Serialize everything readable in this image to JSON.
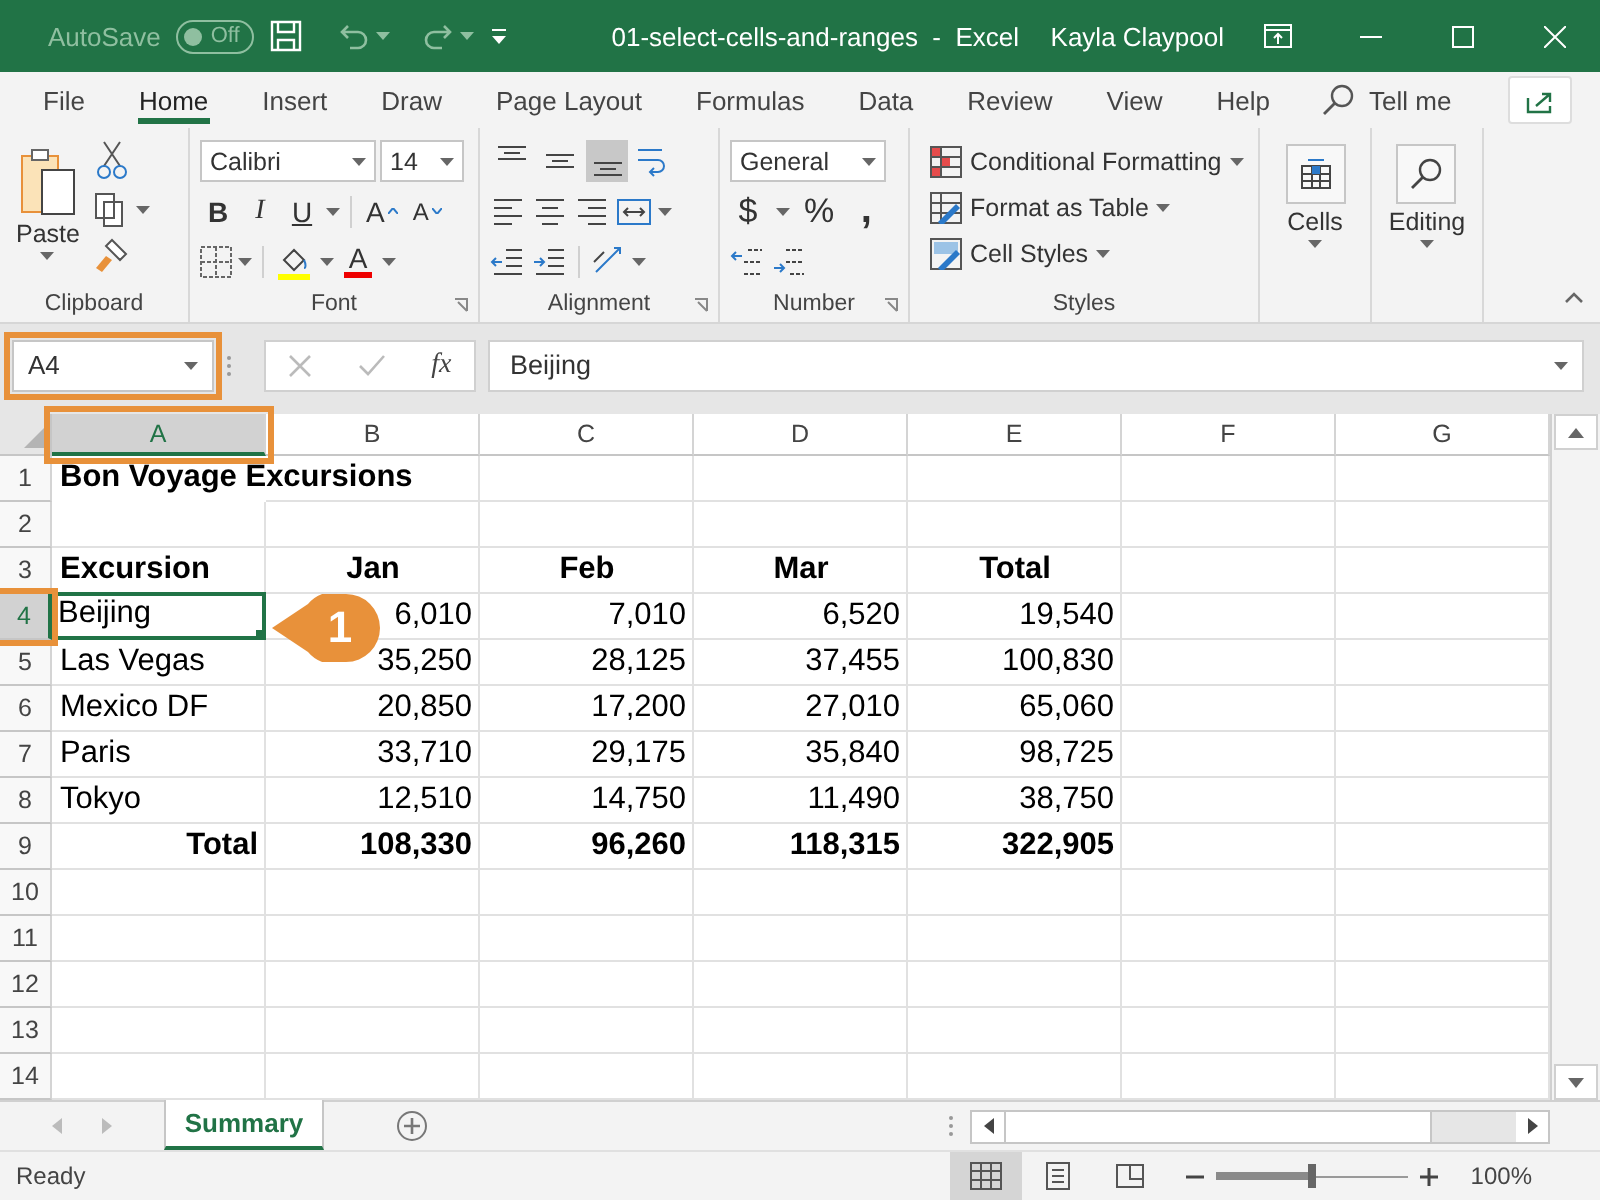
{
  "title_bar": {
    "autosave_label": "AutoSave",
    "autosave_on": false,
    "autosave_state": "Off",
    "title": "01-select-cells-and-ranges  -  Excel",
    "user": "Kayla Claypool"
  },
  "menu_tabs": [
    {
      "label": "File",
      "selected": false
    },
    {
      "label": "Home",
      "selected": true
    },
    {
      "label": "Insert",
      "selected": false
    },
    {
      "label": "Draw",
      "selected": false
    },
    {
      "label": "Page Layout",
      "selected": false
    },
    {
      "label": "Formulas",
      "selected": false
    },
    {
      "label": "Data",
      "selected": false
    },
    {
      "label": "Review",
      "selected": false
    },
    {
      "label": "View",
      "selected": false
    },
    {
      "label": "Help",
      "selected": false
    }
  ],
  "tell_me": "Tell me",
  "ribbon": {
    "groups": [
      {
        "kind": "clipboard",
        "label": "Clipboard",
        "paste": "Paste"
      },
      {
        "kind": "font",
        "label": "Font",
        "font_name": "Calibri",
        "font_size": "14",
        "style_buttons": [
          "B",
          "I",
          "U"
        ],
        "size_buttons": [
          "A",
          "A"
        ],
        "font_color_button": "A"
      },
      {
        "kind": "alignment",
        "label": "Alignment",
        "vertical_buttons": [
          {
            "kind": "top",
            "selected": false
          },
          {
            "kind": "middle",
            "selected": false
          },
          {
            "kind": "bottom",
            "selected": true
          }
        ]
      },
      {
        "kind": "number",
        "label": "Number",
        "format": "General",
        "symbols": [
          "$",
          "%",
          ","
        ]
      },
      {
        "kind": "styles",
        "label": "Styles",
        "items": [
          "Conditional Formatting",
          "Format as Table",
          "Cell Styles"
        ]
      },
      {
        "kind": "cells",
        "button_label": "Cells"
      },
      {
        "kind": "editing",
        "button_label": "Editing"
      }
    ]
  },
  "formula_bar": {
    "name_box": "A4",
    "name_box_highlighted": true,
    "function_label": "fx",
    "formula": "Beijing"
  },
  "sheet": {
    "columns": [
      {
        "label": "A",
        "selected": true,
        "highlighted": true
      },
      {
        "label": "B",
        "selected": false,
        "highlighted": false
      },
      {
        "label": "C",
        "selected": false,
        "highlighted": false
      },
      {
        "label": "D",
        "selected": false,
        "highlighted": false
      },
      {
        "label": "E",
        "selected": false,
        "highlighted": false
      },
      {
        "label": "F",
        "selected": false,
        "highlighted": false
      },
      {
        "label": "G",
        "selected": false,
        "highlighted": false
      }
    ],
    "rows": [
      {
        "number": "1",
        "kind": "title",
        "selected": false,
        "highlighted": false,
        "cells": [
          "Bon Voyage Excursions"
        ]
      },
      {
        "number": "2",
        "kind": "blank",
        "selected": false,
        "highlighted": false
      },
      {
        "number": "3",
        "kind": "header",
        "selected": false,
        "highlighted": false,
        "cells": [
          "Excursion",
          "Jan",
          "Feb",
          "Mar",
          "Total"
        ]
      },
      {
        "number": "4",
        "kind": "data",
        "selected": true,
        "highlighted": true,
        "cells": [
          "Beijing",
          "6,010",
          "7,010",
          "6,520",
          "19,540"
        ]
      },
      {
        "number": "5",
        "kind": "data",
        "selected": false,
        "highlighted": false,
        "cells": [
          "Las Vegas",
          "35,250",
          "28,125",
          "37,455",
          "100,830"
        ]
      },
      {
        "number": "6",
        "kind": "data",
        "selected": false,
        "highlighted": false,
        "cells": [
          "Mexico DF",
          "20,850",
          "17,200",
          "27,010",
          "65,060"
        ]
      },
      {
        "number": "7",
        "kind": "data",
        "selected": false,
        "highlighted": false,
        "cells": [
          "Paris",
          "33,710",
          "29,175",
          "35,840",
          "98,725"
        ]
      },
      {
        "number": "8",
        "kind": "data",
        "selected": false,
        "highlighted": false,
        "cells": [
          "Tokyo",
          "12,510",
          "14,750",
          "11,490",
          "38,750"
        ]
      },
      {
        "number": "9",
        "kind": "total",
        "selected": false,
        "highlighted": false,
        "cells": [
          "Total",
          "108,330",
          "96,260",
          "118,315",
          "322,905"
        ]
      },
      {
        "number": "10",
        "kind": "blank",
        "selected": false,
        "highlighted": false
      },
      {
        "number": "11",
        "kind": "blank",
        "selected": false,
        "highlighted": false
      },
      {
        "number": "12",
        "kind": "blank",
        "selected": false,
        "highlighted": false
      },
      {
        "number": "13",
        "kind": "blank",
        "selected": false,
        "highlighted": false
      },
      {
        "number": "14",
        "kind": "blank",
        "selected": false,
        "highlighted": false
      }
    ]
  },
  "callout": {
    "text": "1"
  },
  "sheet_tabs": [
    {
      "label": "Summary",
      "selected": true
    }
  ],
  "status_bar": {
    "status": "Ready",
    "view_buttons": [
      {
        "kind": "normal",
        "selected": true
      },
      {
        "kind": "page_layout",
        "selected": false
      },
      {
        "kind": "page_break",
        "selected": false
      }
    ],
    "zoom": {
      "level": 0.5,
      "reading": "100%"
    }
  }
}
